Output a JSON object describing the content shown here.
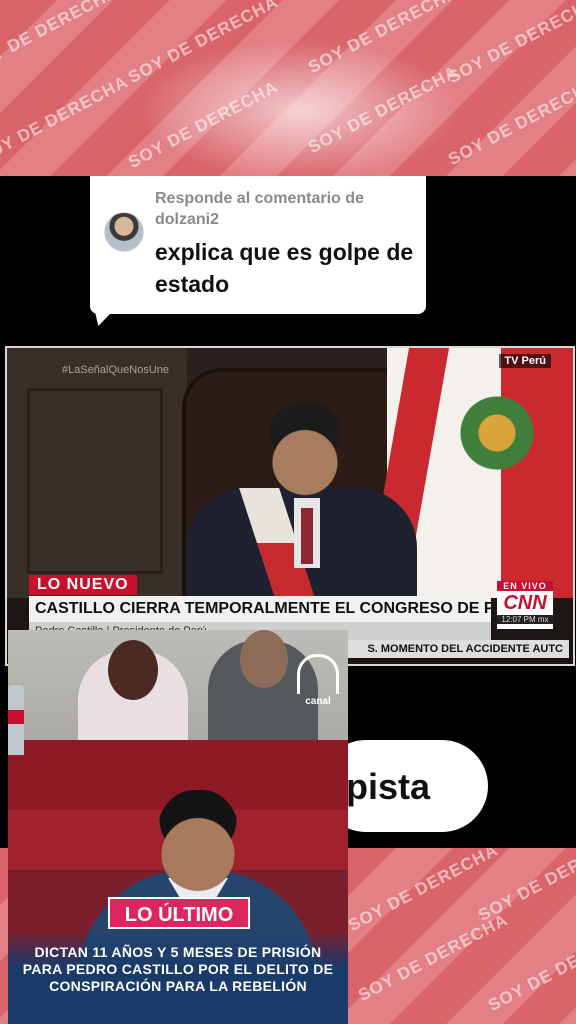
{
  "watermark": {
    "text": "SOY DE DERECHA"
  },
  "reply_card": {
    "prefix": "Responde al comentario de",
    "username": "dolzani2",
    "comment": "explica que es golpe de estado"
  },
  "video": {
    "hashtag": "#LaSeñalQueNosUne",
    "channel_tag": "TV Perú",
    "tag": "LO NUEVO",
    "headline": "CASTILLO CIERRA TEMPORALMENTE EL CONGRESO DE PERÚ",
    "name_line": "Pedro Castillo  |  Presidente de Perú",
    "ticker": "S. MOMENTO DEL ACCIDENTE AUTC",
    "live_label": "EN VIVO",
    "network": "CNN",
    "time": "12:07 PM mx"
  },
  "pill": {
    "text": "lpista"
  },
  "news_card": {
    "logo_label": "canal",
    "badge": "LO ÚLTIMO",
    "headline": "DICTAN 11 AÑOS Y 5 MESES DE PRISIÓN PARA PEDRO CASTILLO POR EL DELITO DE CONSPIRACIÓN PARA LA REBELIÓN"
  },
  "colors": {
    "brand_red": "#c8102e",
    "badge_pink": "#e0245e",
    "watermark_bg": "#d9656b"
  }
}
